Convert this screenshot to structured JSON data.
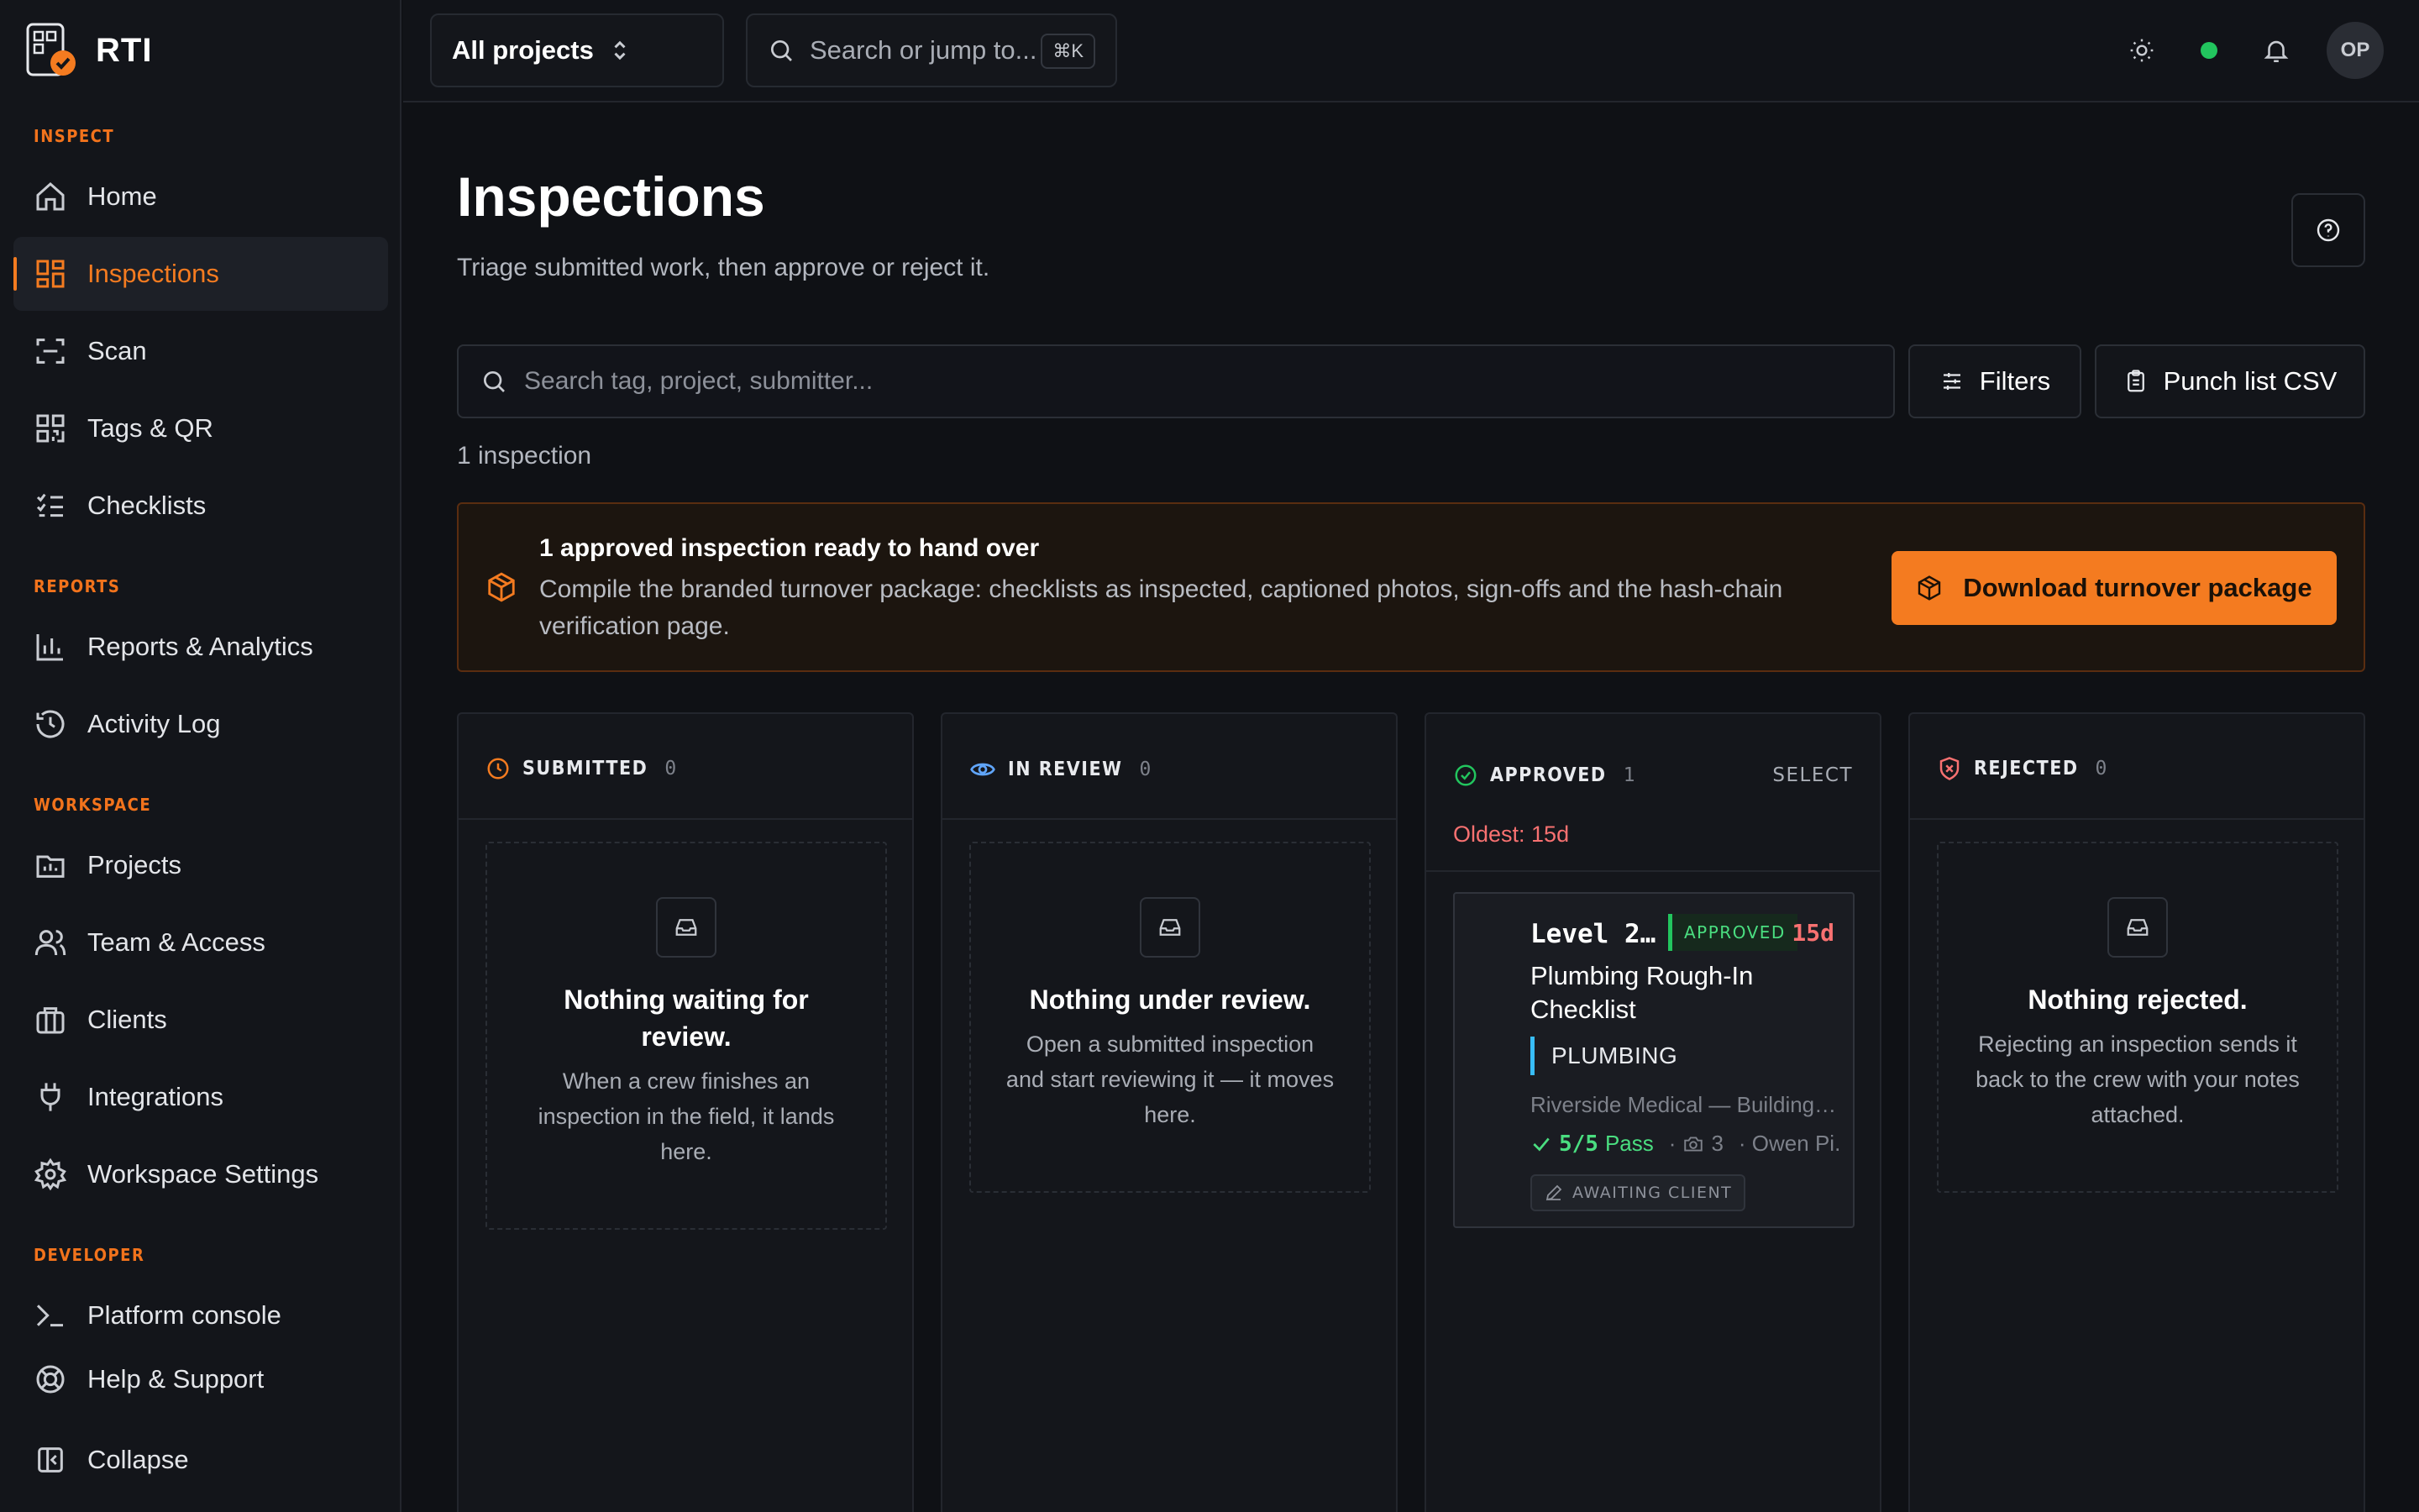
{
  "brand": {
    "name": "RTI"
  },
  "sidebar": {
    "sections": {
      "inspect": "INSPECT",
      "reports": "REPORTS",
      "workspace": "WORKSPACE",
      "developer": "DEVELOPER"
    },
    "items": {
      "home": "Home",
      "inspections": "Inspections",
      "scan": "Scan",
      "tags_qr": "Tags & QR",
      "checklists": "Checklists",
      "reports_analytics": "Reports & Analytics",
      "activity_log": "Activity Log",
      "projects": "Projects",
      "team_access": "Team & Access",
      "clients": "Clients",
      "integrations": "Integrations",
      "workspace_settings": "Workspace Settings",
      "platform_console": "Platform console",
      "help_support": "Help & Support",
      "collapse": "Collapse"
    },
    "active": "inspections"
  },
  "topbar": {
    "project_select": "All projects",
    "search_placeholder": "Search or jump to...",
    "shortcut": "⌘K",
    "avatar_initials": "OP",
    "status_color": "#22c55e"
  },
  "page": {
    "title": "Inspections",
    "subtitle": "Triage submitted work, then approve or reject it.",
    "search_placeholder": "Search tag, project, submitter...",
    "filters_label": "Filters",
    "punch_list_label": "Punch list CSV",
    "count_text": "1 inspection"
  },
  "banner": {
    "title": "1 approved inspection ready to hand over",
    "body": "Compile the branded turnover package: checklists as inspected, captioned photos, sign-offs and the hash-chain verification page.",
    "button_label": "Download turnover package",
    "accent": "#f47b20"
  },
  "columns": {
    "submitted": {
      "title": "SUBMITTED",
      "count": "0",
      "empty_title": "Nothing waiting for review.",
      "empty_text": "When a crew finishes an inspection in the field, it lands here."
    },
    "in_review": {
      "title": "IN REVIEW",
      "count": "0",
      "empty_title": "Nothing under review.",
      "empty_text": "Open a submitted inspection and start reviewing it — it moves here."
    },
    "approved": {
      "title": "APPROVED",
      "count": "1",
      "select_label": "SELECT",
      "oldest": "Oldest: 15d",
      "card": {
        "tag": "Level 2…",
        "badge": "APPROVED",
        "age": "15d",
        "title": "Plumbing Rough-In Checklist",
        "trade": "PLUMBING",
        "project": "Riverside Medical — Building…",
        "pass_count": "5/5",
        "pass_label": "Pass",
        "photos": "3",
        "submitter": "· Owen Pi.",
        "status": "AWAITING CLIENT"
      }
    },
    "rejected": {
      "title": "REJECTED",
      "count": "0",
      "empty_title": "Nothing rejected.",
      "empty_text": "Rejecting an inspection sends it back to the crew with your notes attached."
    }
  }
}
